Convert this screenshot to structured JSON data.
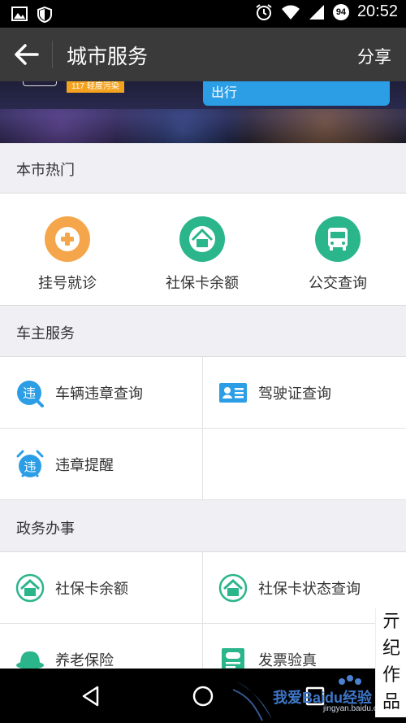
{
  "status_bar": {
    "time": "20:52",
    "badge": "94"
  },
  "app_bar": {
    "title": "城市服务",
    "share_label": "分享"
  },
  "banner": {
    "pollution_text": "117 轻度污染",
    "card_text": "出行"
  },
  "sections": {
    "hot": {
      "title": "本市热门",
      "items": [
        {
          "label": "挂号就诊",
          "icon": "plus-medical-icon",
          "color": "#f5a64a"
        },
        {
          "label": "社保卡余额",
          "icon": "house-icon",
          "color": "#2bb58b"
        },
        {
          "label": "公交查询",
          "icon": "bus-icon",
          "color": "#2bb58b"
        }
      ]
    },
    "car": {
      "title": "车主服务",
      "items": [
        {
          "label": "车辆违章查询",
          "icon": "violation-search-icon"
        },
        {
          "label": "驾驶证查询",
          "icon": "license-card-icon"
        },
        {
          "label": "违章提醒",
          "icon": "violation-alarm-icon"
        }
      ],
      "violation_glyph": "违"
    },
    "gov": {
      "title": "政务办事",
      "items": [
        {
          "label": "社保卡余额",
          "icon": "house-icon"
        },
        {
          "label": "社保卡状态查询",
          "icon": "house-icon"
        },
        {
          "label": "养老保险",
          "icon": "hat-icon"
        },
        {
          "label": "发票验真",
          "icon": "invoice-icon"
        }
      ]
    }
  },
  "watermark": {
    "text": "我爱Baidu经验",
    "sub": "jingyan.baidu.com",
    "stamp_lines": [
      "亓",
      "纪",
      "作",
      "品"
    ]
  },
  "colors": {
    "accent_blue": "#2b9ee6",
    "accent_green": "#2bb58b",
    "accent_orange": "#f5a64a"
  }
}
